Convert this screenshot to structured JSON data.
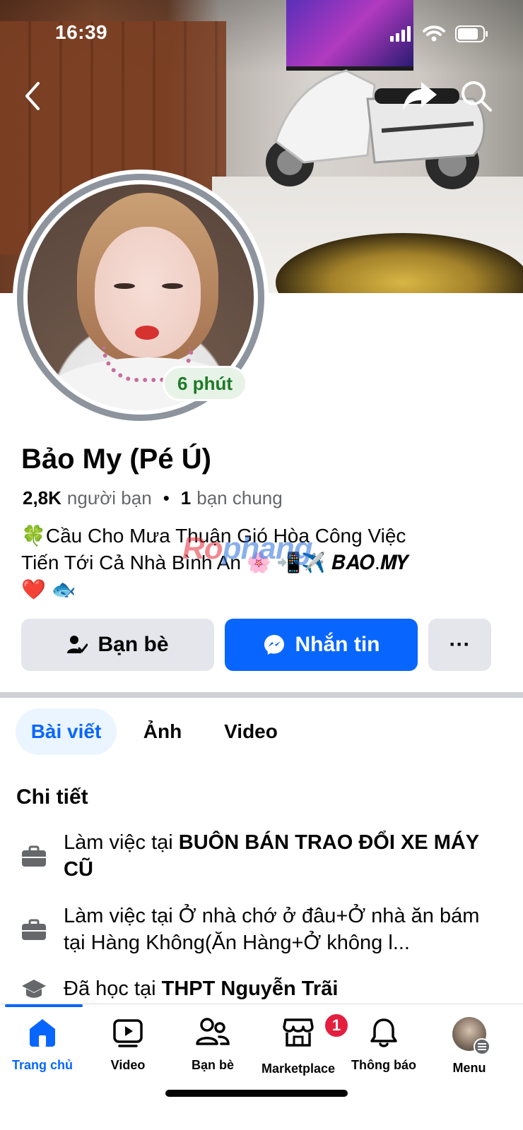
{
  "status_bar": {
    "time": "16:39"
  },
  "profile": {
    "name": "Bảo My (Pé Ú)",
    "story_time": "6 phút",
    "friends_count": "2,8K",
    "friends_label": "người bạn",
    "mutual_count": "1",
    "mutual_label": "bạn chung",
    "bio_line1": "🍀Cầu Cho Mưa Thuận Gió Hòa Công Việc",
    "bio_line2": "Tiến Tới Cả Nhà Bình An 🌸 📲✈️ 𝑩𝑨𝑶.𝑴𝒀",
    "bio_line3": "❤️ 🐟"
  },
  "watermark": {
    "part1": "Ro",
    "part2": "phang"
  },
  "actions": {
    "friends_label": "Bạn bè",
    "message_label": "Nhắn tin",
    "more_label": "···"
  },
  "tabs": {
    "posts": "Bài viết",
    "photos": "Ảnh",
    "videos": "Video"
  },
  "details": {
    "title": "Chi tiết",
    "work1_prefix": "Làm việc tại ",
    "work1_place": "BUÔN BÁN TRAO ĐỔI XE MÁY CŨ",
    "work2_prefix": "Làm việc tại ",
    "work2_place": "Ở nhà chớ ở đâu+Ở nhà ăn bám tại Hàng Không(Ăn Hàng+Ở không l...",
    "edu_prefix": "Đã học tại ",
    "edu_place": "THPT Nguyễn Trãi"
  },
  "bottom_nav": {
    "home": "Trang chủ",
    "video": "Video",
    "friends": "Bạn bè",
    "marketplace": "Marketplace",
    "marketplace_badge": "1",
    "notifications": "Thông báo",
    "menu": "Menu"
  },
  "colors": {
    "accent": "#0866ff",
    "badge": "#e41e3f",
    "story_badge_bg": "#e7f3e6",
    "story_badge_text": "#1f7a28"
  }
}
